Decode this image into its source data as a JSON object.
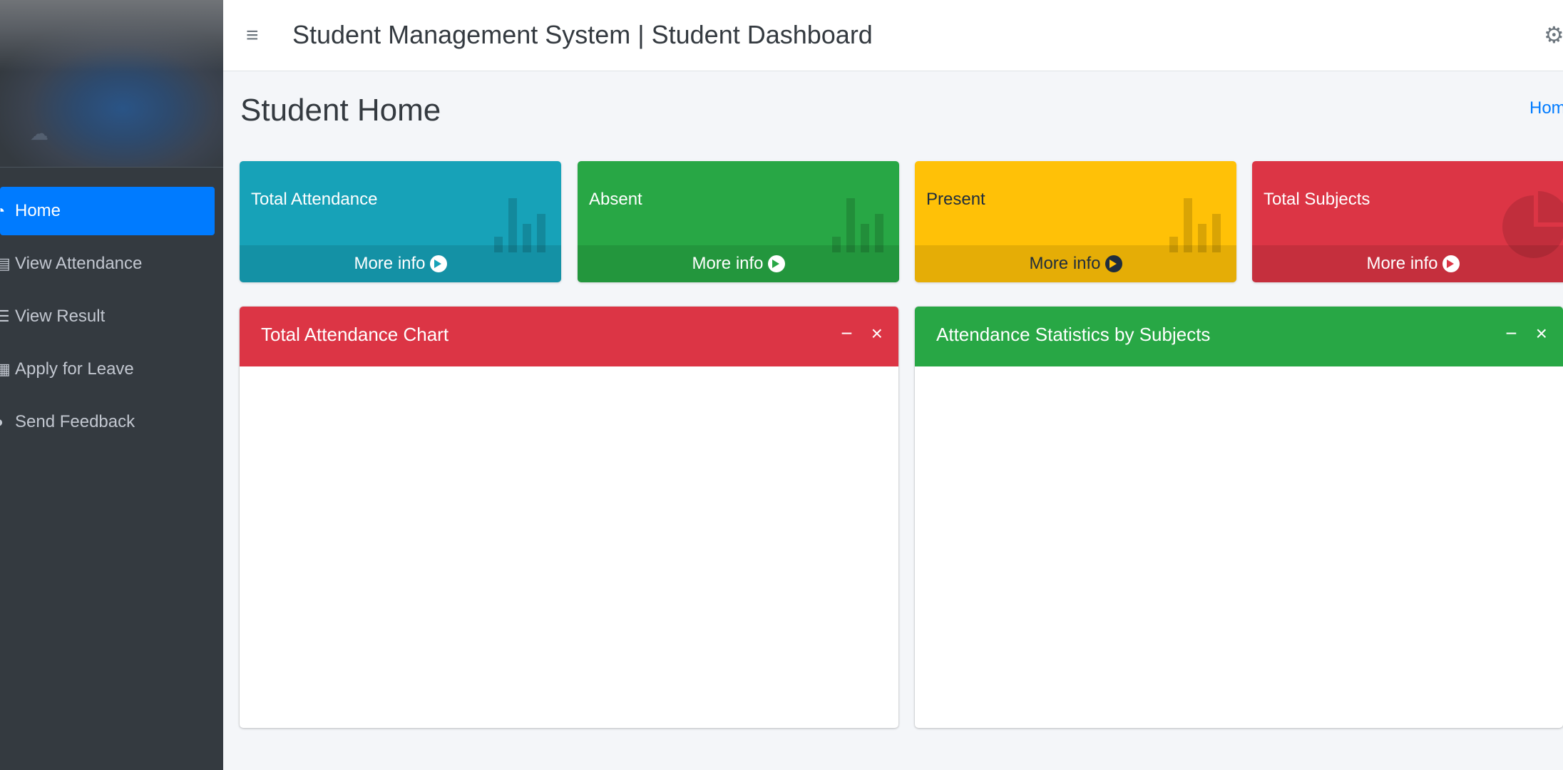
{
  "sidebar": {
    "items": [
      {
        "label": "Home",
        "icon": "dashboard-icon",
        "active": true
      },
      {
        "label": "View Attendance",
        "icon": "calendar-icon"
      },
      {
        "label": "View Result",
        "icon": "list-icon"
      },
      {
        "label": "Apply for Leave",
        "icon": "note-icon"
      },
      {
        "label": "Send Feedback",
        "icon": "chat-icon"
      }
    ]
  },
  "header": {
    "title": "Student Management System | Student Dashboard"
  },
  "page": {
    "title": "Student Home",
    "breadcrumb_home": "Hom"
  },
  "small_boxes": [
    {
      "label": "Total Attendance",
      "footer": "More info",
      "color": "#17a2b8",
      "icon": "bar-chart-icon"
    },
    {
      "label": "Absent",
      "footer": "More info",
      "color": "#28a745",
      "icon": "bar-chart-icon"
    },
    {
      "label": "Present",
      "footer": "More info",
      "color": "#ffc107",
      "icon": "bar-chart-icon"
    },
    {
      "label": "Total Subjects",
      "footer": "More info",
      "color": "#dc3545",
      "icon": "pie-chart-icon"
    }
  ],
  "cards": [
    {
      "title": "Total Attendance Chart",
      "color": "#dc3545",
      "collapse": "−",
      "close": "×"
    },
    {
      "title": "Attendance Statistics by Subjects",
      "color": "#28a745",
      "collapse": "−",
      "close": "×"
    }
  ]
}
